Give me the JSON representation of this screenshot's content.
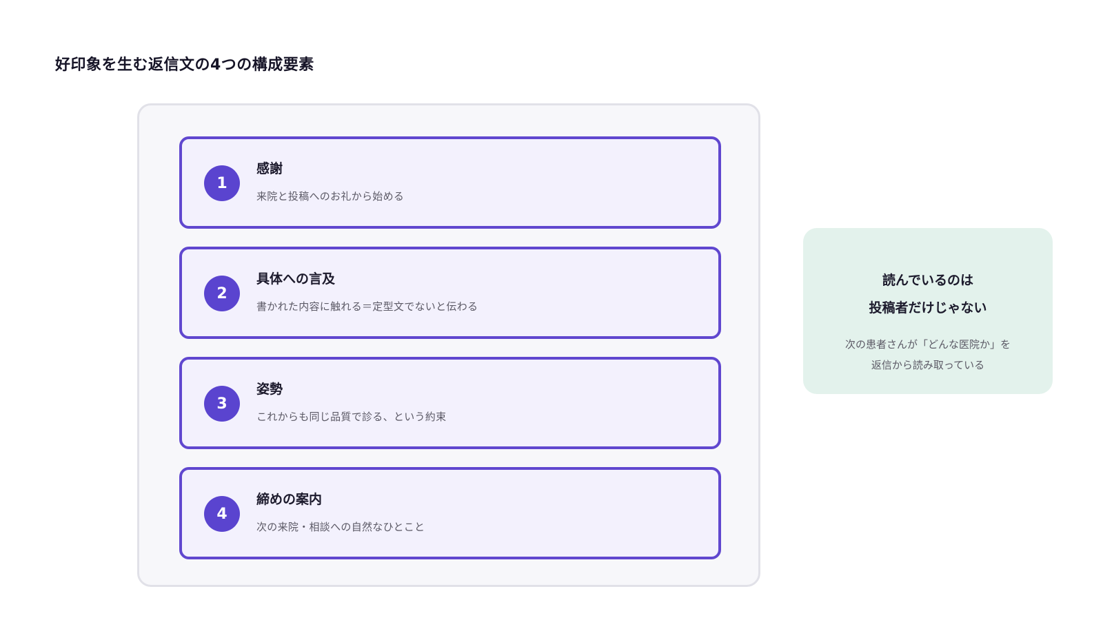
{
  "title": "好印象を生む返信文の4つの構成要素",
  "steps": [
    {
      "number": "1",
      "title": "感謝",
      "description": "来院と投稿へのお礼から始める"
    },
    {
      "number": "2",
      "title": "具体への言及",
      "description": "書かれた内容に触れる＝定型文でないと伝わる"
    },
    {
      "number": "3",
      "title": "姿勢",
      "description": "これからも同じ品質で診る、という約束"
    },
    {
      "number": "4",
      "title": "締めの案内",
      "description": "次の来院・相談への自然なひとこと"
    }
  ],
  "note": {
    "title_line1": "読んでいるのは",
    "title_line2": "投稿者だけじゃない",
    "body_line1": "次の患者さんが「どんな医院か」を",
    "body_line2": "返信から読み取っている"
  },
  "colors": {
    "accent": "#5a44cf",
    "card_background": "#f3f1fd",
    "panel_background": "#f7f7fa",
    "note_background": "#e3f2ec"
  }
}
